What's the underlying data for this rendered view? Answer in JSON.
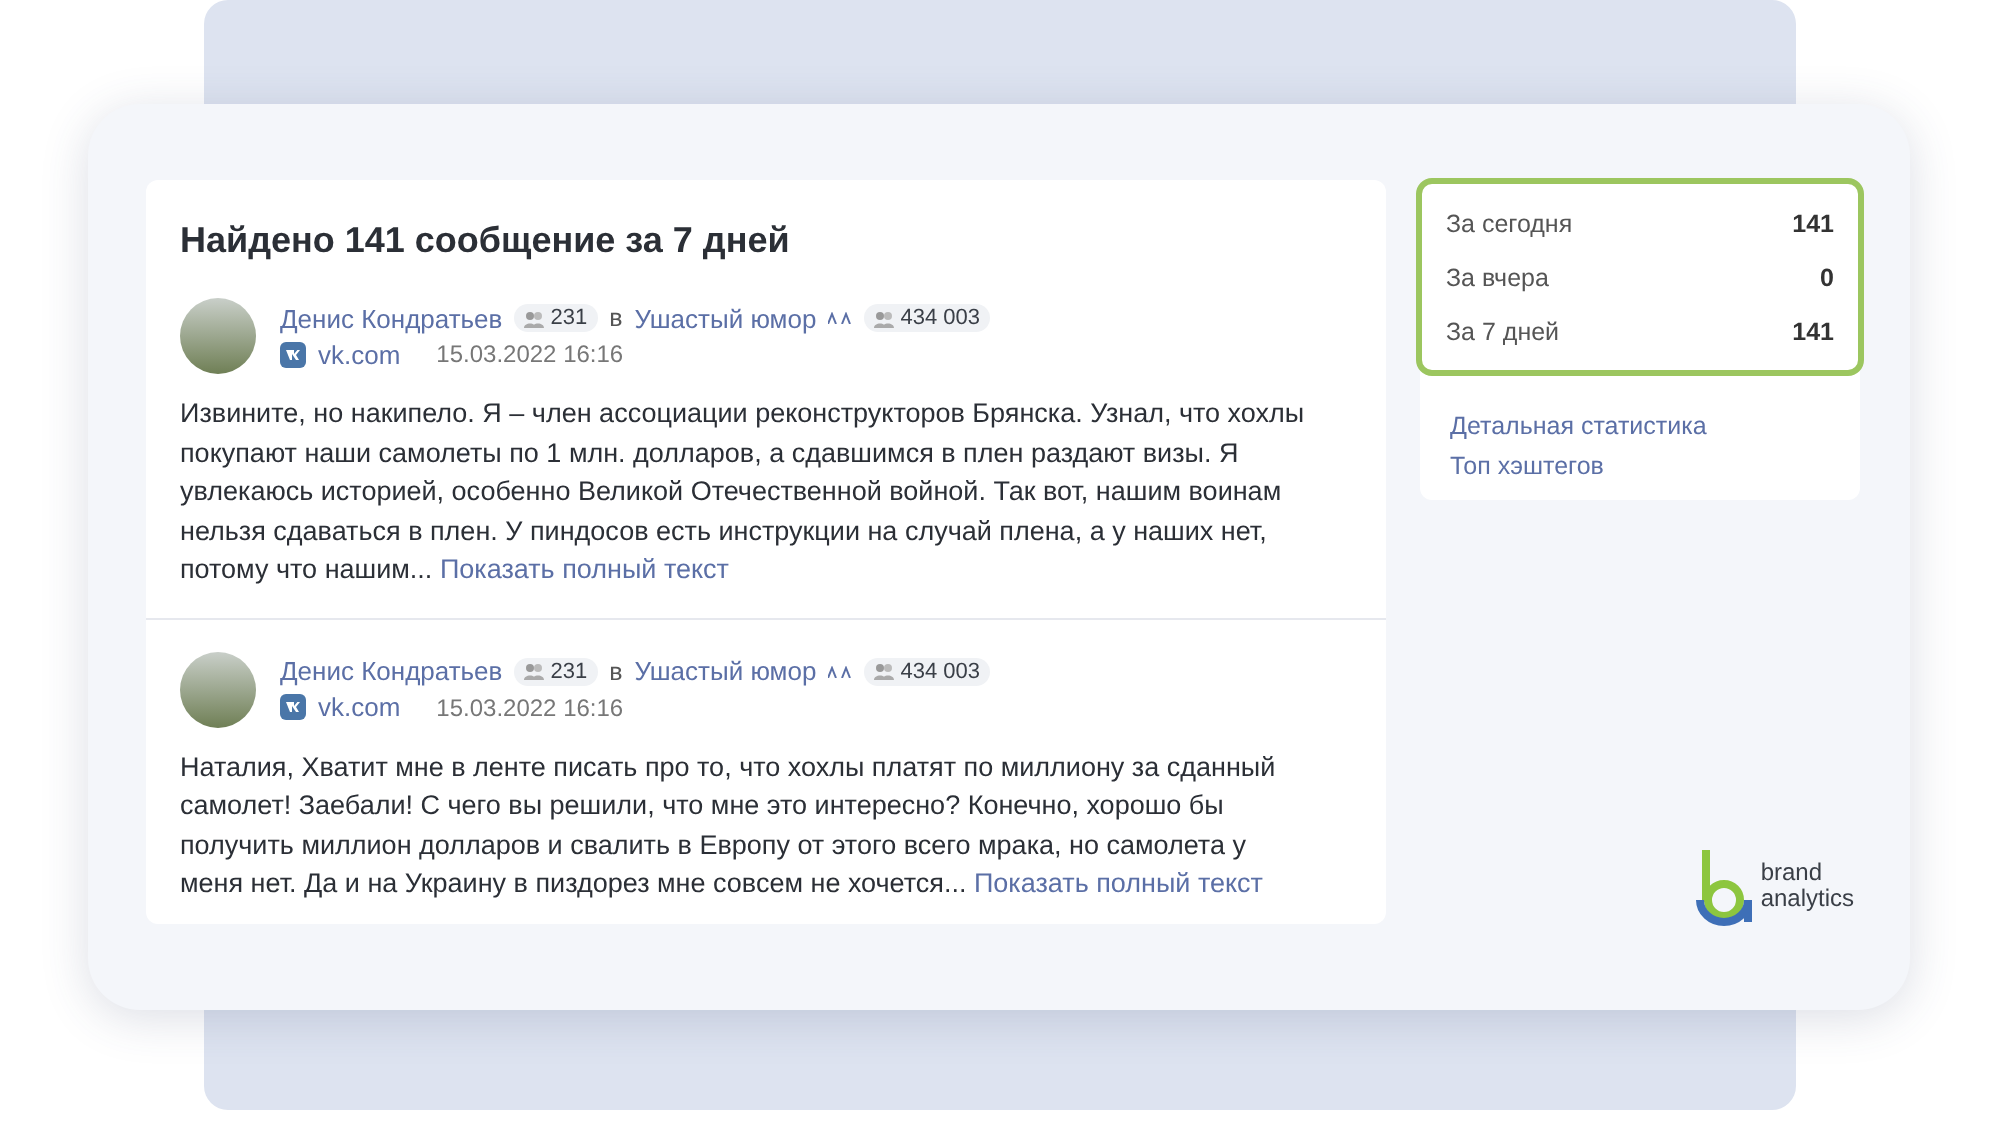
{
  "results": {
    "title": "Найдено 141 сообщение за 7 дней",
    "posts": [
      {
        "author": "Денис Кондратьев",
        "author_count": "231",
        "preposition": "в",
        "group": "Ушастый юмор",
        "group_count": "434 003",
        "source": "vk.com",
        "date": "15.03.2022 16:16",
        "text": "Извините, но накипело. Я – член ассоциации реконструкторов Брянска. Узнал, что хохлы покупают наши самолеты по 1 млн. долларов, а сдавшимся в плен раздают визы. Я увлекаюсь историей, особенно Великой Отечественной войной. Так вот, нашим воинам нельзя сдаваться в плен. У пиндосов есть инструкции на случай плена, а у наших нет, потому что нашим...",
        "more_link": "Показать полный текст"
      },
      {
        "author": "Денис Кондратьев",
        "author_count": "231",
        "preposition": "в",
        "group": "Ушастый юмор",
        "group_count": "434 003",
        "source": "vk.com",
        "date": "15.03.2022 16:16",
        "text": "Наталия, Хватит мне в ленте писать про то, что хохлы платят по миллиону за сданный самолет! Заебали! С чего вы решили, что мне это интересно? Конечно, хорошо бы получить миллион долларов и свалить в Европу от этого всего мрака, но самолета у меня нет. Да и на Украину в пиздорез мне совсем не хочется...",
        "more_link": "Показать полный текст"
      }
    ]
  },
  "stats": {
    "highlighted": true,
    "rows": [
      {
        "label": "За сегодня",
        "value": "141"
      },
      {
        "label": "За вчера",
        "value": "0"
      },
      {
        "label": "За 7 дней",
        "value": "141"
      }
    ],
    "links": [
      "Детальная статистика",
      "Топ хэштегов"
    ]
  },
  "logo": {
    "lines": [
      "brand",
      "analytics"
    ]
  }
}
